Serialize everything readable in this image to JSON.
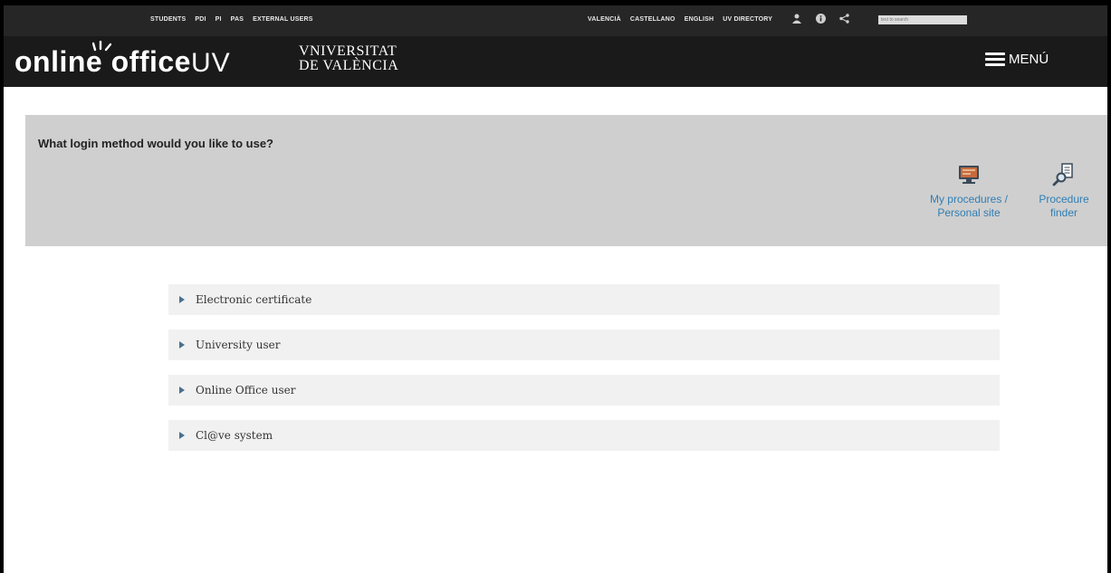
{
  "topbar": {
    "left_links": [
      "STUDENTS",
      "PDI",
      "PI",
      "PAS",
      "EXTERNAL USERS"
    ],
    "right_links": [
      "VALENCIÀ",
      "CASTELLANO",
      "ENGLISH",
      "UV DIRECTORY"
    ],
    "icons": [
      "user-icon",
      "info-icon",
      "share-icon"
    ],
    "search_placeholder": "text to search"
  },
  "header": {
    "brand_part1": "onlin",
    "brand_part2": "e office",
    "brand_part3": "UV",
    "uv_logo_line1": "VNIVERSITAT",
    "uv_logo_line2": "DE VALÈNCIA",
    "menu_label": "MENÚ"
  },
  "panel": {
    "question": "What login method would you like to use?",
    "quick_links": [
      {
        "label": "My procedures / Personal site",
        "icon": "monitor-icon"
      },
      {
        "label": "Procedure finder",
        "icon": "document-search-icon"
      }
    ]
  },
  "login_methods": [
    "Electronic certificate",
    "University user",
    "Online Office user",
    "Cl@ve system"
  ],
  "colors": {
    "topbar_bg": "#262626",
    "header_bg": "#1a1a1a",
    "panel_bg": "#cfcfcf",
    "link_blue": "#2f7fb5",
    "accordion_bg": "#f1f1f1"
  }
}
